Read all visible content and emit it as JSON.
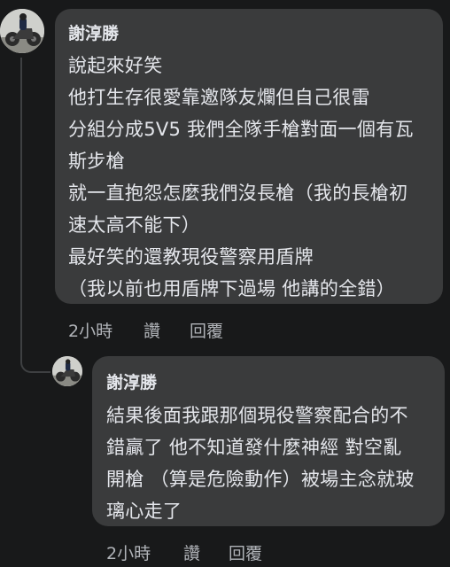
{
  "comment": {
    "author": "謝淳勝",
    "lines": [
      "說起來好笑",
      "他打生存很愛靠邀隊友爛但自己很雷",
      "分組分成5V5 我們全隊手槍對面一個有瓦",
      "斯步槍",
      "就一直抱怨怎麼我們沒長槍（我的長槍初",
      "速太高不能下）",
      "最好笑的還教現役警察用盾牌",
      "（我以前也用盾牌下過場 他講的全錯）"
    ],
    "time": "2小時",
    "like_label": "讚",
    "reply_label": "回覆"
  },
  "reply": {
    "author": "謝淳勝",
    "lines": [
      "結果後面我跟那個現役警察配合的不",
      "錯贏了 他不知道發什麼神經 對空亂",
      "開槍 （算是危險動作）被場主念就玻",
      "璃心走了"
    ],
    "time": "2小時",
    "like_label": "讚",
    "reply_label": "回覆"
  },
  "colors": {
    "background": "#18191a",
    "bubble": "#3a3b3c",
    "text": "#e4e6eb",
    "secondary_text": "#b0b3b8"
  }
}
